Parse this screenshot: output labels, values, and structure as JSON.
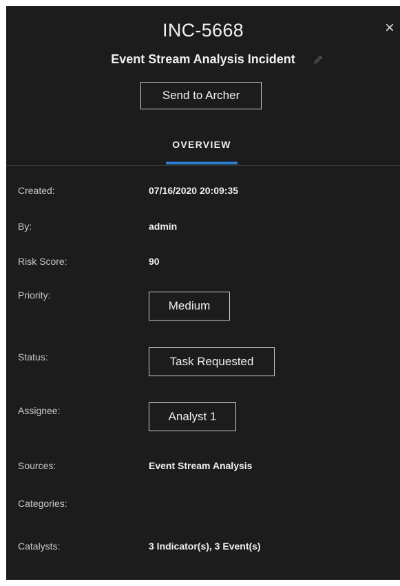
{
  "header": {
    "incident_id": "INC-5668",
    "incident_name": "Event Stream Analysis Incident",
    "close_glyph": "×",
    "edit_icon": "pencil-icon",
    "send_button_label": "Send to Archer"
  },
  "tabs": [
    {
      "label": "OVERVIEW",
      "active": true
    }
  ],
  "accent_color": "#2f7fd0",
  "fields": {
    "created": {
      "label": "Created:",
      "value": "07/16/2020 20:09:35"
    },
    "by": {
      "label": "By:",
      "value": "admin"
    },
    "risk_score": {
      "label": "Risk Score:",
      "value": "90"
    },
    "priority": {
      "label": "Priority:",
      "value": "Medium"
    },
    "status": {
      "label": "Status:",
      "value": "Task Requested"
    },
    "assignee": {
      "label": "Assignee:",
      "value": "Analyst 1"
    },
    "sources": {
      "label": "Sources:",
      "value": "Event Stream Analysis"
    },
    "categories": {
      "label": "Categories:",
      "value": ""
    },
    "catalysts": {
      "label": "Catalysts:",
      "value": "3 Indicator(s), 3 Event(s)"
    }
  }
}
